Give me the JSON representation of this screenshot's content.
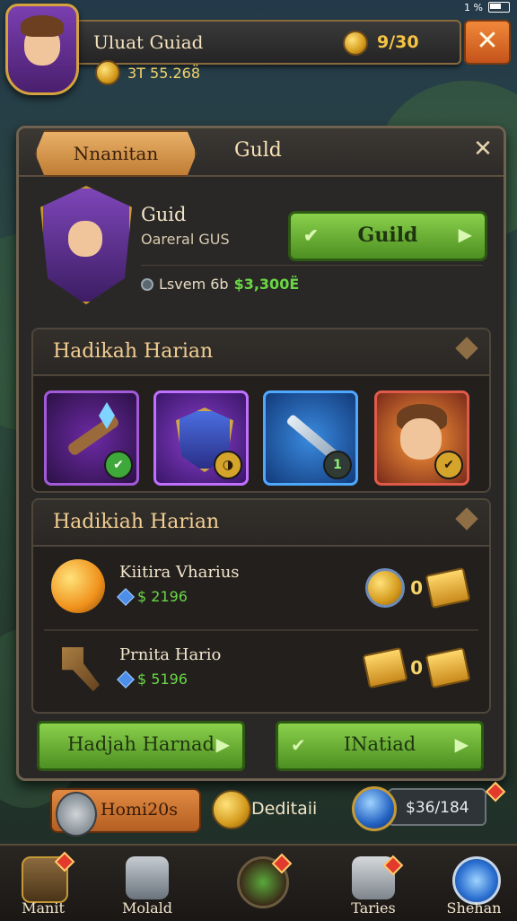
{
  "status": {
    "time": "1 %"
  },
  "header": {
    "title": "Uluat Guiad",
    "counter": "9/30",
    "gold": "3T 55.268̈",
    "close_symbol": "✕"
  },
  "panel": {
    "tab_label": "Nnanitan",
    "title": "Guld",
    "close_symbol": "✕",
    "guild": {
      "name": "Guid",
      "subtitle": "Oareral GUS",
      "button_label": "Guild",
      "stat_label": "Lsvem 6b",
      "stat_value": "$3,300Ë"
    }
  },
  "daily_section": {
    "title": "Hadikah Harian",
    "rewards": [
      {
        "name": "staff",
        "badge": "✔",
        "badge_color": "#3fa83a"
      },
      {
        "name": "shield",
        "badge": "◑",
        "badge_color": "#d4a52a"
      },
      {
        "name": "sword",
        "badge": "1",
        "badge_color": "#2f3b34"
      },
      {
        "name": "hero",
        "badge": "✔",
        "badge_color": "#d4a52a"
      }
    ]
  },
  "shop_section": {
    "title": "Hadikiah Harian",
    "items": [
      {
        "name": "Kiitira Vharius",
        "price": "$ 2196",
        "cost": "0"
      },
      {
        "name": "Prnita Hario",
        "price": "$ 5196",
        "cost": "0"
      }
    ]
  },
  "buttons": {
    "left": "Hadjah Harnad",
    "right": "INatiad"
  },
  "currency": {
    "pill_label": "Homi20s",
    "coin_label": "Deditaii",
    "box_value": "$36/184"
  },
  "nav": [
    {
      "label": "Manit"
    },
    {
      "label": "Molald"
    },
    {
      "label": ""
    },
    {
      "label": "Taries"
    },
    {
      "label": "Shehan"
    }
  ]
}
